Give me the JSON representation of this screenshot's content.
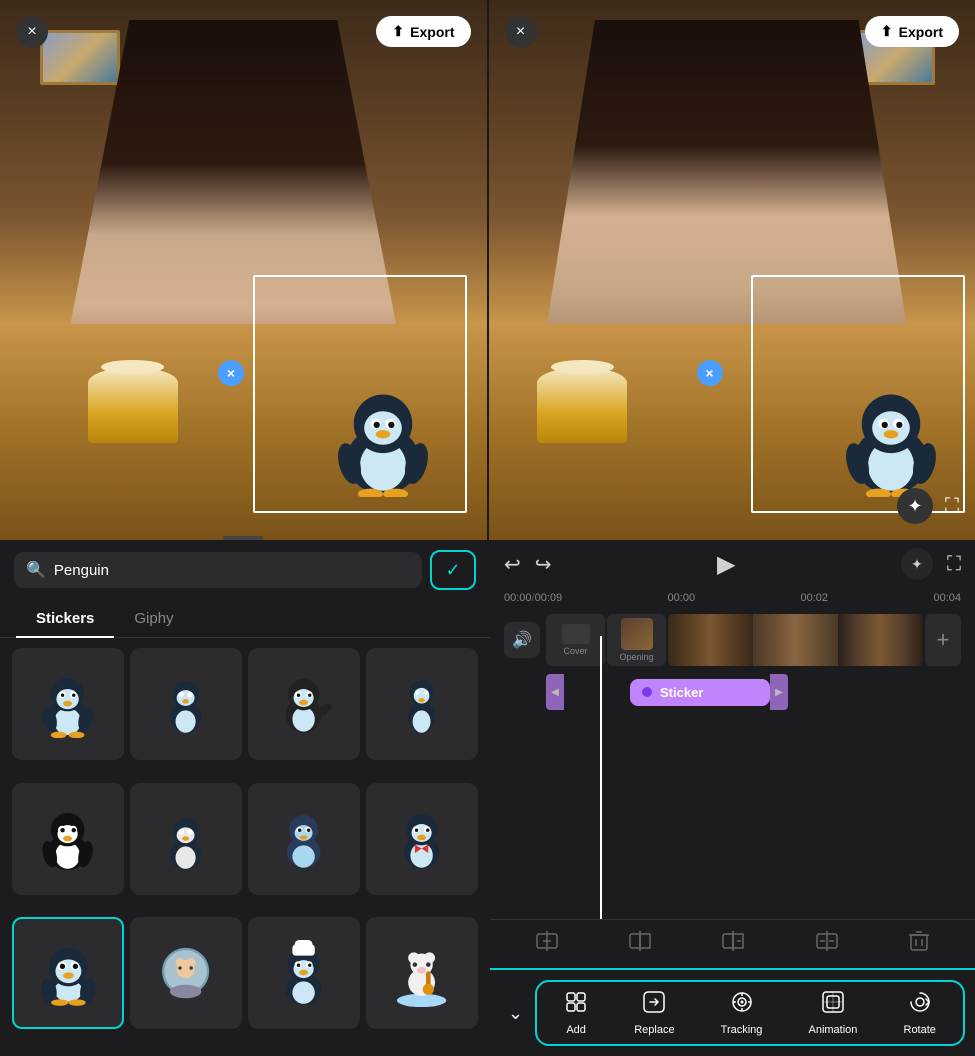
{
  "panels": {
    "left": {
      "export_label": "Export",
      "close_label": "×"
    },
    "right": {
      "export_label": "Export",
      "close_label": "×"
    }
  },
  "search": {
    "placeholder": "Penguin",
    "value": "Penguin",
    "confirm_icon": "✓"
  },
  "tabs": {
    "stickers_label": "Stickers",
    "giphy_label": "Giphy"
  },
  "sticker_grid": {
    "items": [
      {
        "id": 1,
        "type": "penguin-emperor",
        "selected": false
      },
      {
        "id": 2,
        "type": "penguin-small",
        "selected": false
      },
      {
        "id": 3,
        "type": "penguin-waving",
        "selected": false
      },
      {
        "id": 4,
        "type": "penguin-tiny",
        "selected": false
      },
      {
        "id": 5,
        "type": "penguin-black",
        "selected": false
      },
      {
        "id": 6,
        "type": "penguin-walking",
        "selected": false
      },
      {
        "id": 7,
        "type": "penguin-blue",
        "selected": false
      },
      {
        "id": 8,
        "type": "penguin-formal",
        "selected": false
      },
      {
        "id": 9,
        "type": "penguin-round",
        "selected": true
      },
      {
        "id": 10,
        "type": "snowglobe-bear",
        "selected": false
      },
      {
        "id": 11,
        "type": "penguin-chef",
        "selected": false
      },
      {
        "id": 12,
        "type": "bear-guitar",
        "selected": false
      }
    ]
  },
  "timeline": {
    "current_time": "00:00",
    "total_time": "00:09",
    "markers": [
      "00:00",
      "00:02",
      "00:04"
    ],
    "cover_label": "Cover",
    "opening_label": "Opening",
    "sticker_label": "Sticker",
    "add_icon": "+"
  },
  "playback": {
    "undo_icon": "↩",
    "redo_icon": "↪",
    "play_icon": "▶",
    "magic_icon": "✦",
    "fullscreen_icon": "⛶"
  },
  "edit_tools": {
    "split_add_icon": "⊞",
    "split_left_icon": "⊣",
    "split_right_icon": "⊢",
    "split_both_icon": "⊤",
    "delete_icon": "🗑"
  },
  "bottom_actions": {
    "collapse_icon": "⌄",
    "items": [
      {
        "label": "Add",
        "icon": "✦"
      },
      {
        "label": "Replace",
        "icon": "⬛"
      },
      {
        "label": "Tracking",
        "icon": "◎"
      },
      {
        "label": "Animation",
        "icon": "▣"
      },
      {
        "label": "Rotate",
        "icon": "↻"
      }
    ]
  }
}
